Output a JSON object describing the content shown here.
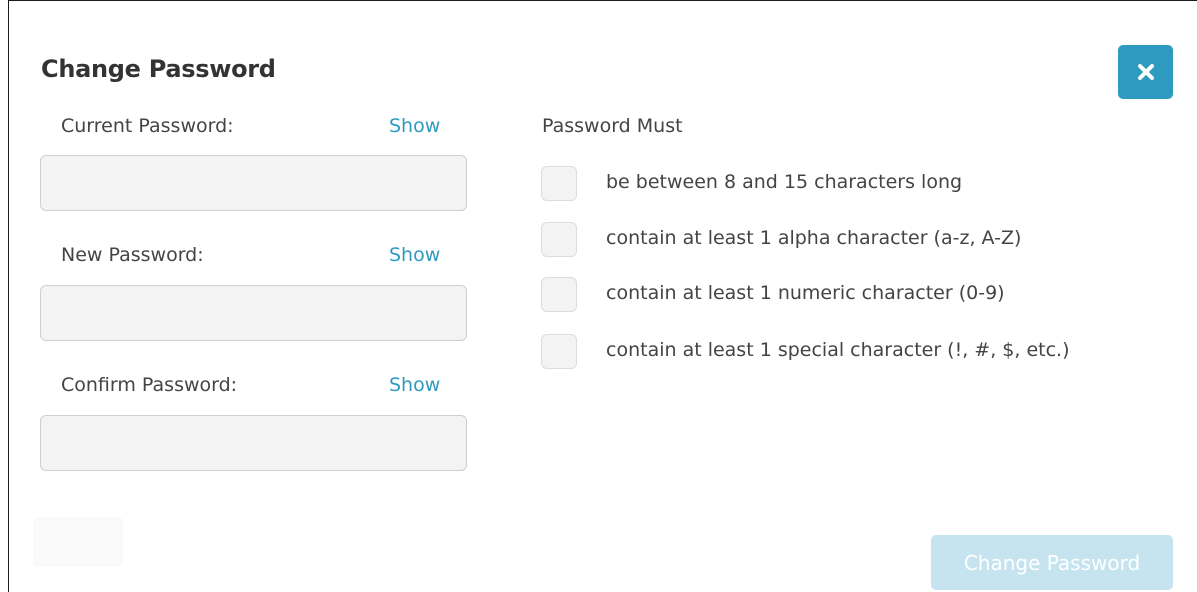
{
  "dialog": {
    "title": "Change Password",
    "close_icon": "close-icon",
    "accent_color": "#2f9ac0"
  },
  "fields": {
    "current": {
      "label": "Current Password:",
      "show_label": "Show",
      "value": ""
    },
    "new": {
      "label": "New Password:",
      "show_label": "Show",
      "value": ""
    },
    "confirm": {
      "label": "Confirm Password:",
      "show_label": "Show",
      "value": ""
    }
  },
  "requirements": {
    "title": "Password Must",
    "items": [
      {
        "text": "be between 8 and 15 characters long",
        "met": false
      },
      {
        "text": "contain at least 1 alpha character (a-z, A-Z)",
        "met": false
      },
      {
        "text": "contain at least 1 numeric character (0-9)",
        "met": false
      },
      {
        "text": "contain at least 1 special character (!, #, $, etc.)",
        "met": false
      }
    ]
  },
  "submit": {
    "label": "Change Password",
    "disabled": true
  }
}
